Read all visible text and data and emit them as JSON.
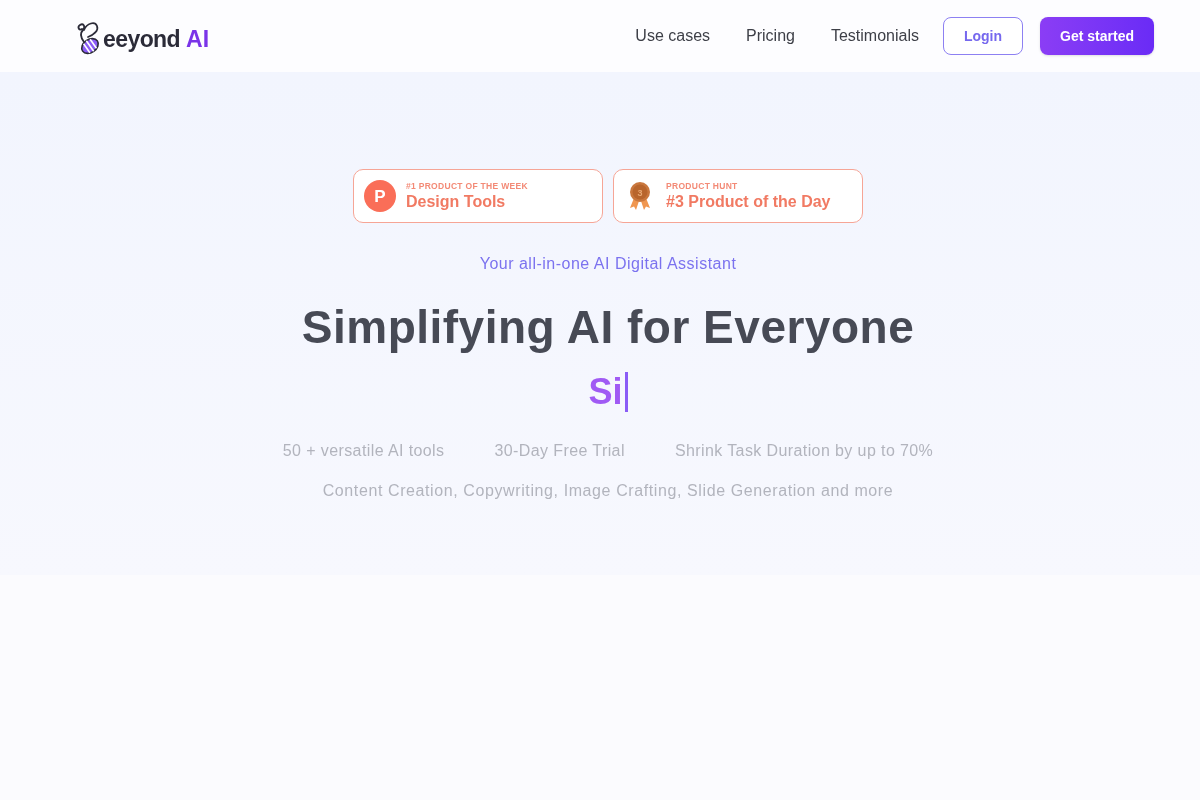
{
  "nav": {
    "logo": {
      "text": "eeyond",
      "accent": "AI"
    },
    "links": [
      {
        "label": "Use cases"
      },
      {
        "label": "Pricing"
      },
      {
        "label": "Testimonials"
      }
    ],
    "buttons": [
      {
        "label": "Login",
        "kind": "outline"
      },
      {
        "label": "Get started",
        "kind": "primary"
      }
    ]
  },
  "hero": {
    "badges": [
      {
        "kind": "product-hunt",
        "icon_text": "P",
        "eyebrow": "#1 PRODUCT OF THE WEEK",
        "title": "Design Tools"
      },
      {
        "kind": "medal",
        "icon_text": "3",
        "eyebrow": "PRODUCT HUNT",
        "title": "#3 Product of the Day"
      }
    ],
    "tagline": "Your all-in-one AI Digital Assistant",
    "title": "Simplifying AI for Everyone",
    "typewriter": {
      "text": "Si",
      "cursor": true
    },
    "features": [
      "50 + versatile AI tools",
      "30-Day Free Trial",
      "Shrink Task Duration by up to 70%"
    ],
    "description": "Content Creation, Copywriting, Image Crafting, Slide Generation and more"
  }
}
